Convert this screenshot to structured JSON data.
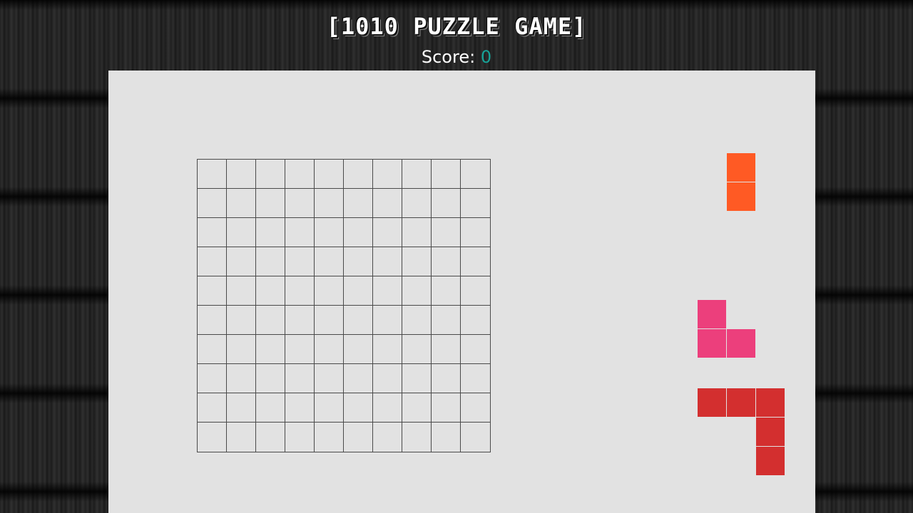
{
  "header": {
    "title": "[1010 PUZZLE GAME]",
    "score_label": "Score:",
    "score_value": "0"
  },
  "board": {
    "rows": 10,
    "cols": 10,
    "filled": []
  },
  "pieces": [
    {
      "name": "piece-orange-vertical-2",
      "color": "#ff5a24",
      "cells": [
        [
          0,
          0
        ],
        [
          1,
          0
        ]
      ]
    },
    {
      "name": "piece-pink-corner-3",
      "color": "#ec3f7c",
      "cells": [
        [
          0,
          0
        ],
        [
          1,
          0
        ],
        [
          1,
          1
        ]
      ]
    },
    {
      "name": "piece-red-corner-5",
      "color": "#d32f2f",
      "cells": [
        [
          0,
          0
        ],
        [
          0,
          1
        ],
        [
          0,
          2
        ],
        [
          1,
          2
        ],
        [
          2,
          2
        ]
      ]
    }
  ],
  "colors": {
    "panel_background": "#e2e2e2",
    "grid_line": "#4a4a4a",
    "score_accent": "#17a398"
  }
}
